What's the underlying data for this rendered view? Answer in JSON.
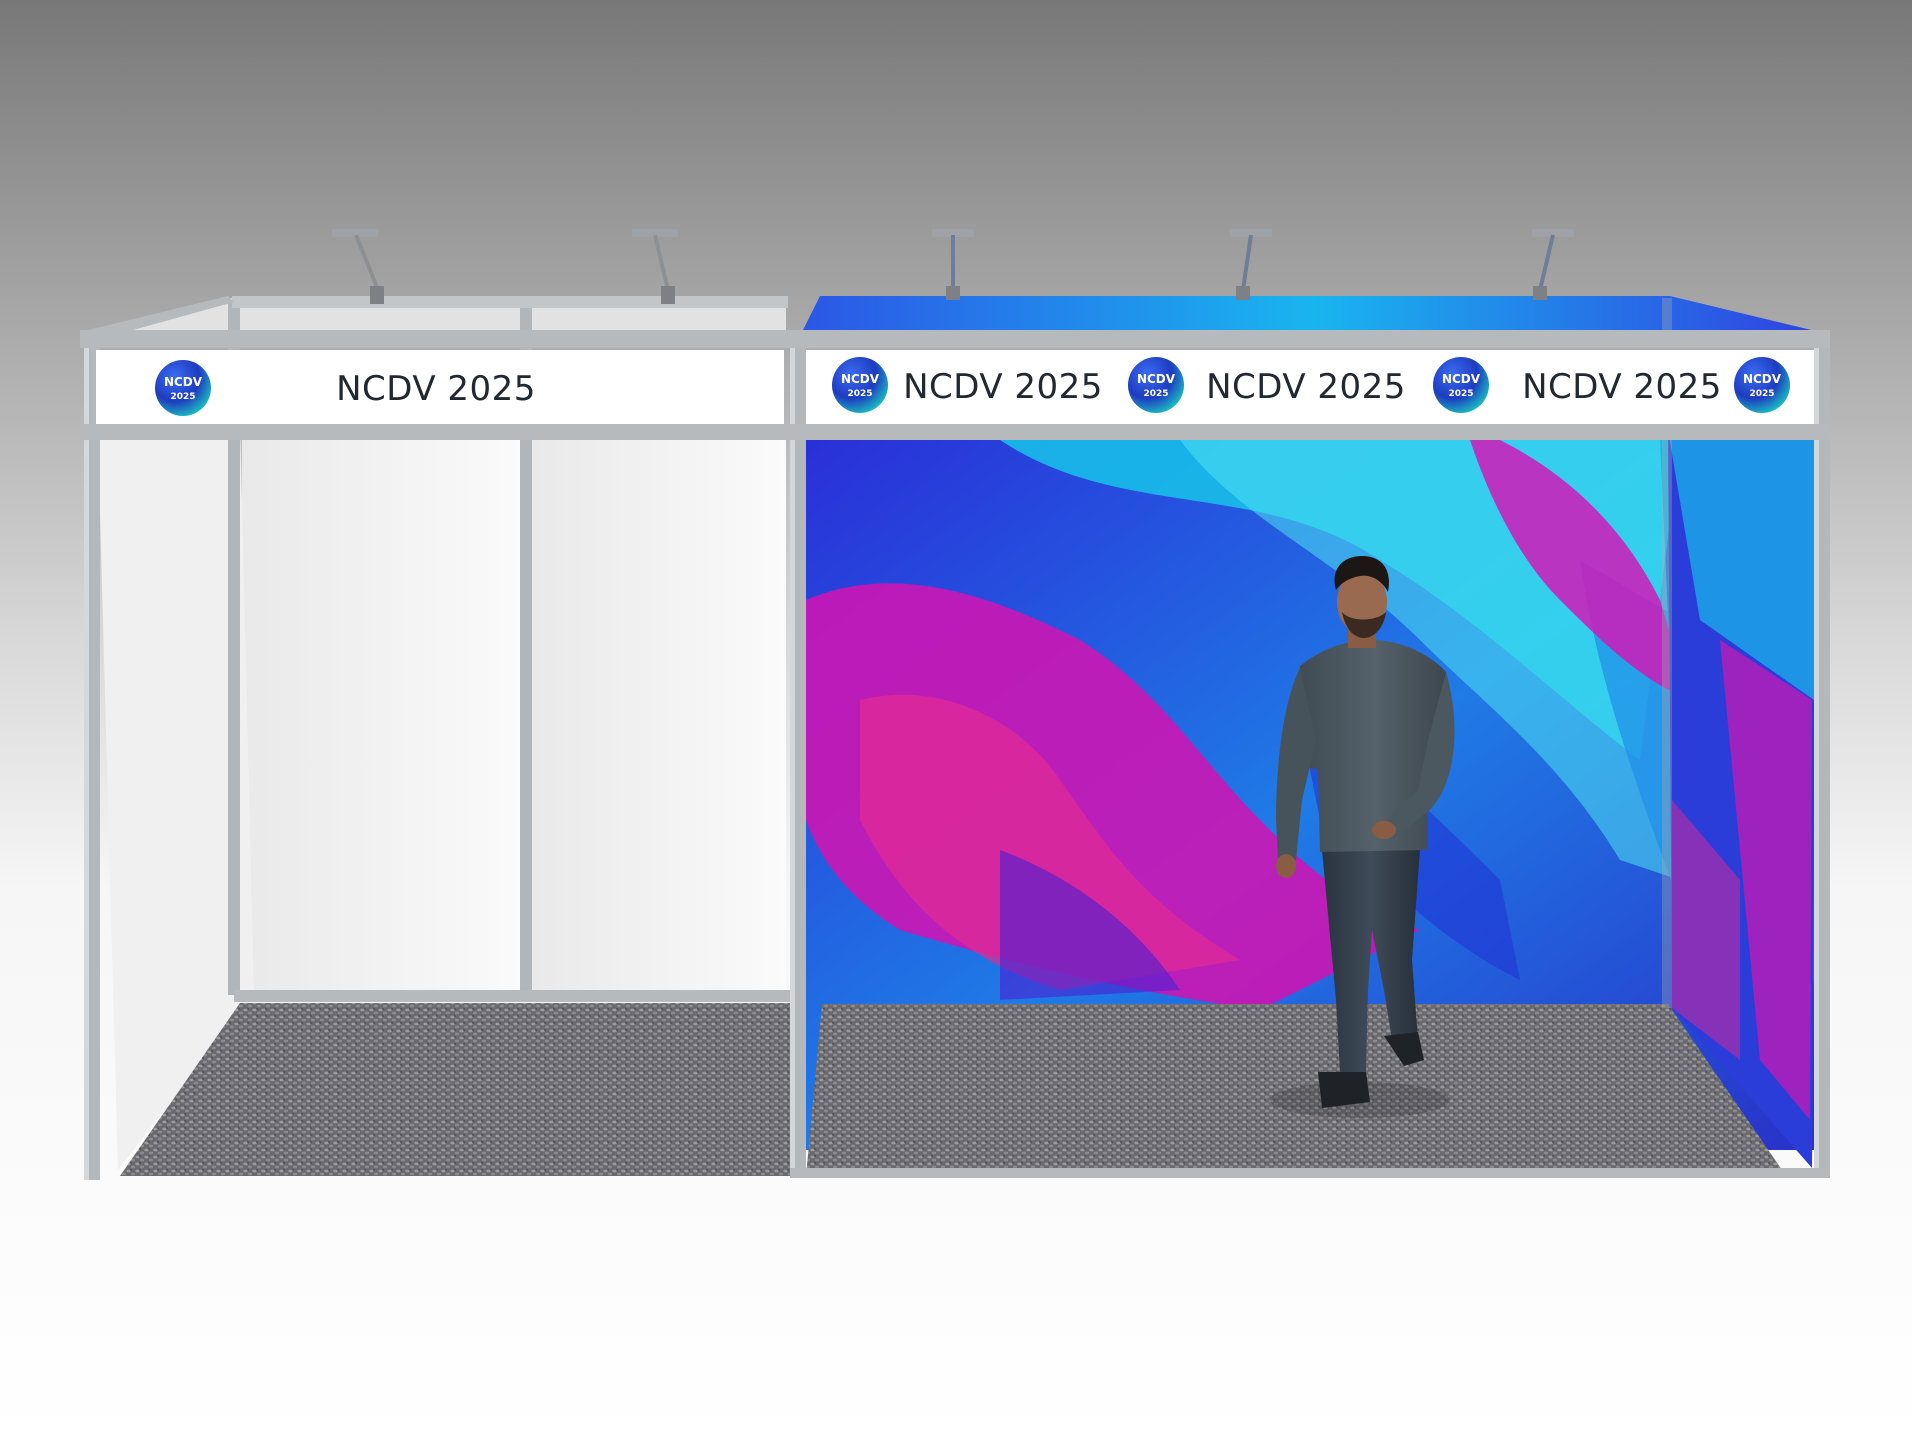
{
  "scene": {
    "colors": {
      "background_top": "#7a7a7a",
      "background_bottom": "#ffffff",
      "frame": "#b7babd",
      "fascia": "#ffffff",
      "panel": "#f4f4f4",
      "carpet": "#707074",
      "graphic_blue": "#1b3fd8",
      "graphic_cyan": "#19c6e8",
      "graphic_magenta": "#c416b8"
    }
  },
  "left_booth": {
    "fascia": {
      "logo": {
        "line1": "NCDV",
        "line2": "2025"
      },
      "text": "NCDV 2025"
    }
  },
  "right_booth": {
    "fascia": {
      "repeats": [
        {
          "text": "NCDV 2025"
        },
        {
          "text": "NCDV 2025"
        },
        {
          "text": "NCDV 2025"
        }
      ],
      "logo": {
        "line1": "NCDV",
        "line2": "2025"
      }
    }
  }
}
